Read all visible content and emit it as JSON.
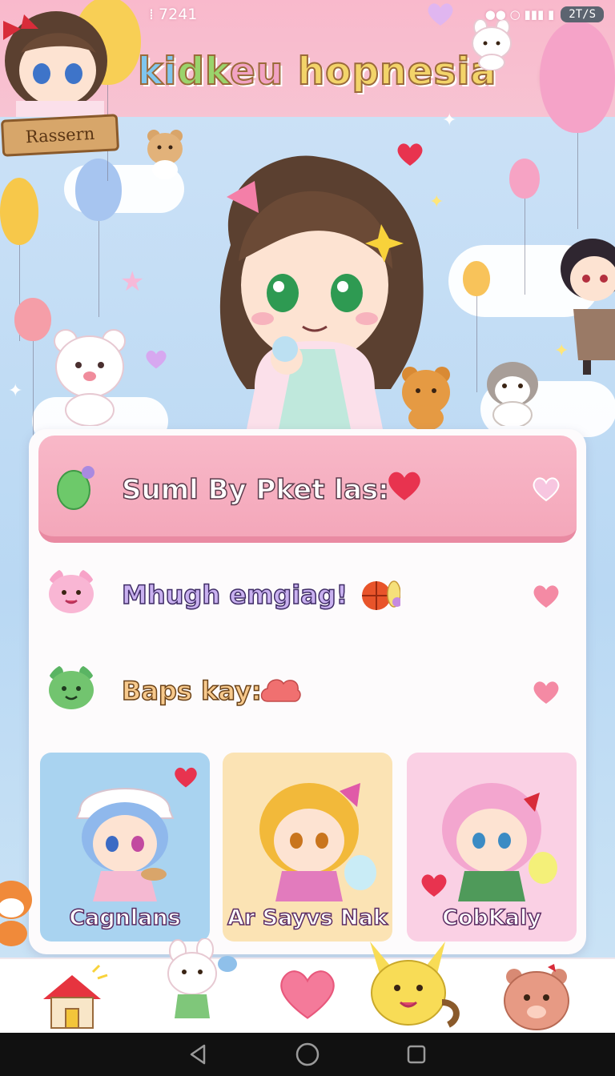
{
  "status_bar": {
    "time": "7241",
    "battery": "2T/S"
  },
  "header": {
    "title": "kidkeu hopnesia",
    "title_parts": [
      "ki",
      "dk",
      "eu",
      " hopnesia"
    ],
    "profile_icon": "smiley-face-icon"
  },
  "scene": {
    "sign_text": "Rassern"
  },
  "main": {
    "banner": {
      "text": "Suml By Pket las:",
      "icon": "green-balloon-icon",
      "action_icon": "heart-icon"
    },
    "rows": [
      {
        "text": "Mhugh emgiag!",
        "icon": "pink-bear-icon",
        "action_icon": "heart-icon"
      },
      {
        "text": "Baps kay:",
        "icon": "green-bear-icon",
        "action_icon": "heart-icon"
      }
    ],
    "cards": [
      {
        "label": "Cagnlans",
        "color": "#a9d3f0"
      },
      {
        "label": "Ar Sayvs Nak",
        "color": "#fbe3b4"
      },
      {
        "label": "CobKaly",
        "color": "#fad0e4"
      }
    ]
  },
  "bottom_nav": {
    "items": [
      "home-icon",
      "bunny-icon",
      "heart-icon",
      "yellow-creature-icon",
      "bear-face-icon"
    ]
  },
  "colors": {
    "header_pink": "#f9b9cc",
    "banner_pink": "#f4a7ba",
    "heart_red": "#f0506e",
    "sky": "#b9d8f3"
  }
}
